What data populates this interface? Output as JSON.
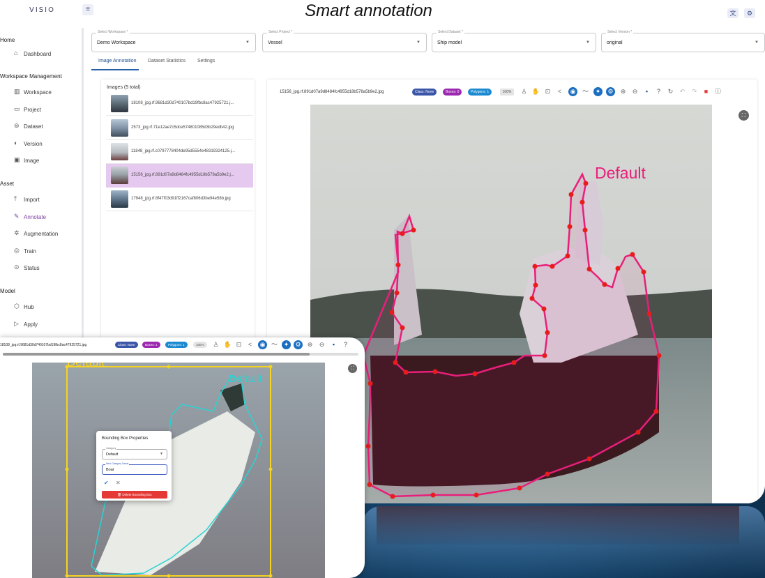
{
  "app": {
    "brand": "VISIO",
    "heading": "Smart annotation"
  },
  "sidebar": {
    "sections": [
      {
        "label": "Home",
        "items": [
          {
            "label": "Dashboard",
            "icon": "home-icon"
          }
        ]
      },
      {
        "label": "Workspace Management",
        "items": [
          {
            "label": "Workspace",
            "icon": "building-icon"
          },
          {
            "label": "Project",
            "icon": "folder-icon"
          },
          {
            "label": "Dataset",
            "icon": "database-icon"
          },
          {
            "label": "Version",
            "icon": "version-icon"
          },
          {
            "label": "Image",
            "icon": "image-icon"
          }
        ]
      },
      {
        "label": "Asset",
        "items": [
          {
            "label": "Import",
            "icon": "upload-icon"
          },
          {
            "label": "Annotate",
            "icon": "annotate-icon"
          },
          {
            "label": "Augmentation",
            "icon": "augmentation-icon"
          },
          {
            "label": "Train",
            "icon": "train-icon"
          },
          {
            "label": "Status",
            "icon": "status-icon"
          }
        ]
      },
      {
        "label": "Model",
        "items": [
          {
            "label": "Hub",
            "icon": "hub-icon"
          },
          {
            "label": "Apply",
            "icon": "apply-icon"
          }
        ]
      }
    ],
    "active_item": "Annotate"
  },
  "selects": [
    {
      "label": "Select Workspace *",
      "value": "Demo Workspace"
    },
    {
      "label": "Select Project *",
      "value": "Vessel"
    },
    {
      "label": "Select Dataset *",
      "value": "Ship model"
    },
    {
      "label": "Select Version *",
      "value": "original"
    }
  ],
  "tabs": [
    {
      "label": "Image Annotation",
      "active": true
    },
    {
      "label": "Dataset Statistics",
      "active": false
    },
    {
      "label": "Settings",
      "active": false
    }
  ],
  "image_list": {
    "title": "Images (5 total)",
    "items": [
      {
        "filename": "18108_jpg.rf.9681d30d740107bd19fbc8ac47925721.j...",
        "selected": false
      },
      {
        "filename": "2573_jpg.rf.71e12ae7c5dce574801085d3b29edb42.jpg",
        "selected": false
      },
      {
        "filename": "11848_jpg.rf.c0797778404de95d5554e48319324125.j...",
        "selected": false
      },
      {
        "filename": "15156_jpg.rf.891d07a9d8484fc4955d18b578a5b9e2.j...",
        "selected": true
      },
      {
        "filename": "17948_jpg.rf.8f47f03d91ff2167caf806d3be94e58b.jpg",
        "selected": false
      }
    ]
  },
  "viewer": {
    "filename": "15156_jpg.rf.891d07a9d8484fc4955d18b578a5b9e2.jpg",
    "class_pill": "Class: None",
    "boxes_pill": "Boxes: 0",
    "polygons_pill": "Polygons: 1",
    "zoom": "100%",
    "annotation_label": "Default",
    "colors": {
      "class_pill": "#3b55a8",
      "boxes_pill": "#9c27b0",
      "polygons_pill": "#1b8ad1",
      "polygon": "#e91e7a",
      "vertex": "#e81c1c"
    }
  },
  "inset": {
    "filename": "18108_jpg.rf.9681d30d740107bd19fbc8ac47925721.jpg",
    "class_pill": "Class: None",
    "boxes_pill": "Boxes: 1",
    "polygons_pill": "Polygons: 1",
    "zoom": "100%",
    "box_label": "Default",
    "polygon_label": "Default",
    "colors": {
      "box": "#f5d320",
      "polygon": "#2ad3d3"
    },
    "dialog": {
      "title": "Bounding Box Properties",
      "category_label": "Category",
      "category_value": "Default",
      "new_category_label": "New Category Name",
      "new_category_value": "Boat",
      "delete_label": "Delete Bounding Box"
    }
  }
}
